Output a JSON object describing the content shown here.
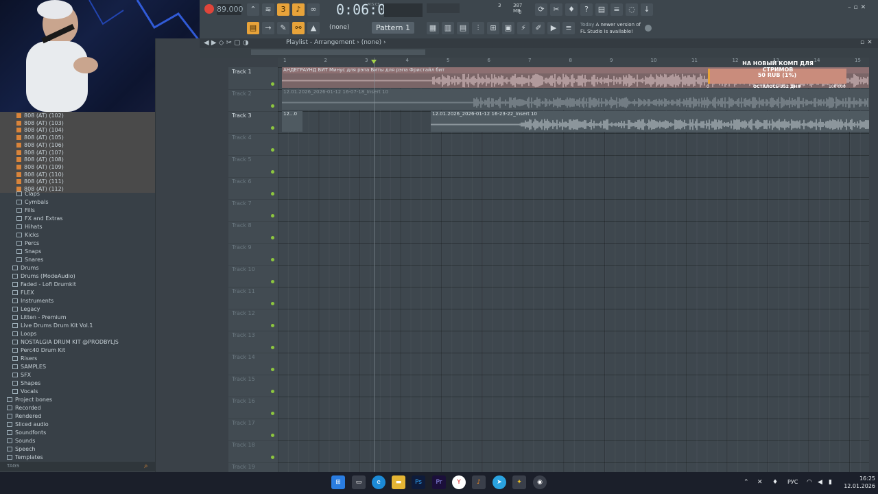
{
  "toolbar": {
    "tempo": "89.000",
    "time": "0:06:06",
    "time_unit": "M:S:CS",
    "pattern": "Pattern 1",
    "snap": "(none)",
    "cpu_value": "3",
    "memory": "387 MB",
    "poly": "0",
    "hint_today": "Today",
    "hint_text_1": "A newer version of",
    "hint_text_2": "FL Studio is available!"
  },
  "playlist": {
    "title": "Playlist - Arrangement",
    "pattern_sel": "(none)",
    "ruler": [
      "1",
      "2",
      "3",
      "4",
      "5",
      "6",
      "7",
      "8",
      "9",
      "10",
      "11",
      "12",
      "13",
      "14",
      "15"
    ],
    "tracks": [
      {
        "name": "Track 1",
        "active": true
      },
      {
        "name": "Track 2",
        "active": false
      },
      {
        "name": "Track 3",
        "active": true
      },
      {
        "name": "Track 4",
        "active": false
      },
      {
        "name": "Track 5",
        "active": false
      },
      {
        "name": "Track 6",
        "active": false
      },
      {
        "name": "Track 7",
        "active": false
      },
      {
        "name": "Track 8",
        "active": false
      },
      {
        "name": "Track 9",
        "active": false
      },
      {
        "name": "Track 10",
        "active": false
      },
      {
        "name": "Track 11",
        "active": false
      },
      {
        "name": "Track 12",
        "active": false
      },
      {
        "name": "Track 13",
        "active": false
      },
      {
        "name": "Track 14",
        "active": false
      },
      {
        "name": "Track 15",
        "active": false
      },
      {
        "name": "Track 16",
        "active": false
      },
      {
        "name": "Track 17",
        "active": false
      },
      {
        "name": "Track 18",
        "active": false
      },
      {
        "name": "Track 19",
        "active": false
      }
    ],
    "clips": {
      "clip1": "АНДЕГРАУНД БИТ  Минус для рэпа  Биты для рэпа  Фристайл бит",
      "clip2": "12.01.2026_2026-01-12 16-07-18_Insert 10",
      "clip3a": "12...0",
      "clip3b": "12.01.2026_2026-01-12 16-23-22_Insert 10"
    }
  },
  "donation": {
    "title": "НА НОВЫЙ КОМП ДЛЯ СТРИМОВ",
    "amount": "50 RUB (1%)",
    "remaining": "ОСТАЛОСЬ 352 ДНЯ",
    "min": "0",
    "max": "100 000"
  },
  "browser": {
    "files": [
      "808 (AT) (102)",
      "808 (AT) (103)",
      "808 (AT) (104)",
      "808 (AT) (105)",
      "808 (AT) (106)",
      "808 (AT) (107)",
      "808 (AT) (108)",
      "808 (AT) (109)",
      "808 (AT) (110)",
      "808 (AT) (111)",
      "808 (AT) (112)"
    ],
    "subfolders": [
      "Claps",
      "Cymbals",
      "Fills",
      "FX and Extras",
      "Hihats",
      "Kicks",
      "Percs",
      "Snaps",
      "Snares"
    ],
    "folders": [
      "Drums",
      "Drums (ModeAudio)",
      "Faded - Lofi Drumkit",
      "FLEX",
      "Instruments",
      "Legacy",
      "Litten - Premium",
      "Live Drums Drum Kit Vol.1",
      "Loops",
      "NOSTALGIA DRUM KIT @PRODBYLJS",
      "Perc40 Drum Kit",
      "Risers",
      "SAMPLES",
      "SFX",
      "Shapes",
      "Vocals"
    ],
    "root": [
      "Project bones",
      "Recorded",
      "Rendered",
      "Sliced audio",
      "Soundfonts",
      "Sounds",
      "Speech",
      "Templates"
    ],
    "tags_label": "TAGS"
  },
  "taskbar": {
    "lang": "РУС",
    "time": "16:25",
    "date": "12.01.2026",
    "apps": [
      "windows-start",
      "file-explorer",
      "edge",
      "folder",
      "photoshop",
      "premiere",
      "yandex",
      "fl-studio",
      "telegram",
      "fl-studio-2",
      "obs"
    ]
  },
  "colors": {
    "accent": "#e8a33a",
    "record": "#e0453a",
    "led": "#8dc63f"
  }
}
